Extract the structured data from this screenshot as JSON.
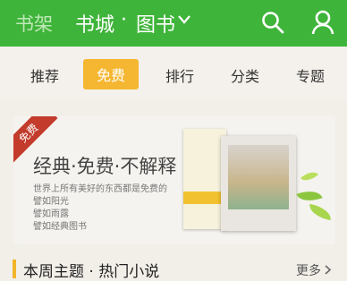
{
  "header": {
    "shelf_label": "书架",
    "store_label": "书城",
    "separator": "·",
    "books_label": "图书",
    "icons": [
      "chevron-down-icon",
      "search-icon",
      "user-icon"
    ]
  },
  "categories": {
    "items": [
      "推荐",
      "免费",
      "排行",
      "分类",
      "专题"
    ],
    "active": "免费"
  },
  "banner": {
    "badge": "免费",
    "title": "经典·免费·不解释",
    "lines": [
      "世界上所有美好的东西都是免费的",
      "譬如阳光",
      "譬如雨露",
      "譬如经典图书"
    ]
  },
  "section": {
    "title": "本周主题 · 热门小说",
    "more_label": "更多"
  },
  "colors": {
    "topbar": "#3fb43a",
    "active_tab": "#f5b731",
    "badge": "#c23b2b",
    "section_accent": "#f1b52b"
  }
}
